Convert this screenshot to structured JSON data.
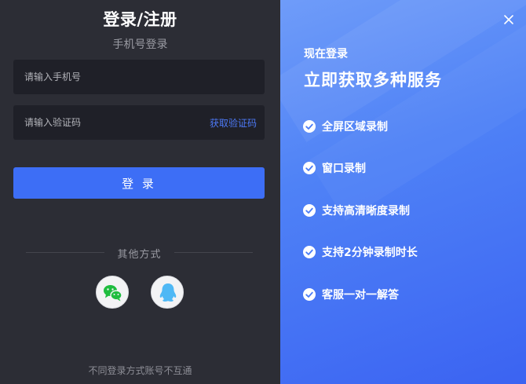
{
  "login": {
    "title": "登录/注册",
    "subtitle": "手机号登录",
    "phone_placeholder": "请输入手机号",
    "code_placeholder": "请输入验证码",
    "get_code_label": "获取验证码",
    "login_button": "登 录",
    "other_methods": "其他方式",
    "footnote": "不同登录方式账号不互通"
  },
  "social": [
    {
      "name": "wechat-icon",
      "color": "#1fbd3f"
    },
    {
      "name": "qq-icon",
      "color": "#4fb8f5"
    }
  ],
  "promo": {
    "small": "现在登录",
    "big": "立即获取多种服务",
    "features": [
      "全屏区域录制",
      "窗口录制",
      "支持高清晰度录制",
      "支持2分钟录制时长",
      "客服一对一解答"
    ]
  },
  "colors": {
    "accent": "#3d6ef6",
    "link": "#4d79f6",
    "panel_dark": "#2c2d35",
    "field_bg": "#1f2028"
  },
  "icons": {
    "close": "close-icon",
    "check": "check-circle-icon"
  }
}
